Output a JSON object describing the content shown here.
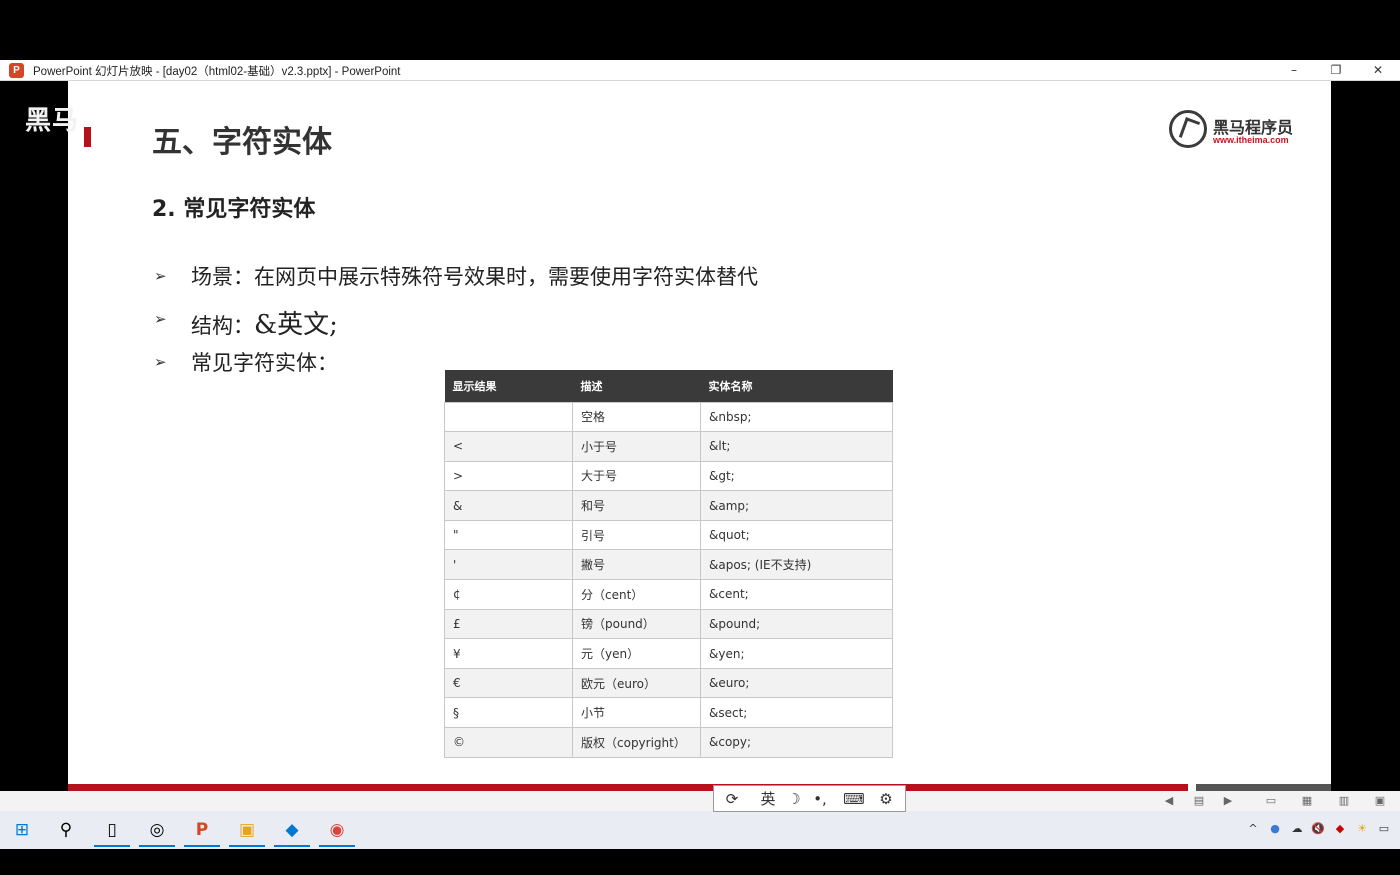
{
  "window": {
    "app_icon": "P",
    "title": "PowerPoint 幻灯片放映 - [day02（html02-基础）v2.3.pptx] - PowerPoint",
    "minimize": "–",
    "maximize": "❐",
    "close": "✕"
  },
  "slide": {
    "watermark": "黑马",
    "title": "五、字符实体",
    "logo": {
      "name": "黑马程序员",
      "url": "www.itheima.com"
    },
    "subtitle": "2. 常见字符实体",
    "bullet_marker": "➢",
    "bullets": [
      {
        "text": "场景：在网页中展示特殊符号效果时，需要使用字符实体替代"
      },
      {
        "label": "结构：",
        "code": "&英文;"
      },
      {
        "text": "常见字符实体："
      }
    ],
    "table": {
      "headers": [
        "显示结果",
        "描述",
        "实体名称"
      ],
      "rows": [
        [
          "",
          "空格",
          "&nbsp;"
        ],
        [
          "<",
          "小于号",
          "&lt;"
        ],
        [
          ">",
          "大于号",
          "&gt;"
        ],
        [
          "&",
          "和号",
          "&amp;"
        ],
        [
          "\"",
          "引号",
          "&quot;"
        ],
        [
          "'",
          "撇号",
          "&apos; (IE不支持)"
        ],
        [
          "¢",
          "分（cent）",
          "&cent;"
        ],
        [
          "£",
          "镑（pound）",
          "&pound;"
        ],
        [
          "¥",
          "元（yen）",
          "&yen;"
        ],
        [
          "€",
          "欧元（euro）",
          "&euro;"
        ],
        [
          "§",
          "小节",
          "&sect;"
        ],
        [
          "©",
          "版权（copyright）",
          "&copy;"
        ]
      ]
    }
  },
  "ime": {
    "items": [
      "⟳",
      "英",
      "☽",
      "•,",
      "⌨",
      "⚙"
    ]
  },
  "statusbar": {
    "buttons": [
      "◀",
      "▤",
      "▶",
      "▭",
      "▦",
      "▥",
      "▣"
    ]
  },
  "taskbar": {
    "icons": [
      "⊞",
      "⚲",
      "▯",
      "◎",
      "P",
      "▣",
      "◆",
      "◉"
    ],
    "tray": [
      "^",
      "●",
      "☁",
      "🔇",
      "◆",
      "☀",
      "▭"
    ]
  }
}
